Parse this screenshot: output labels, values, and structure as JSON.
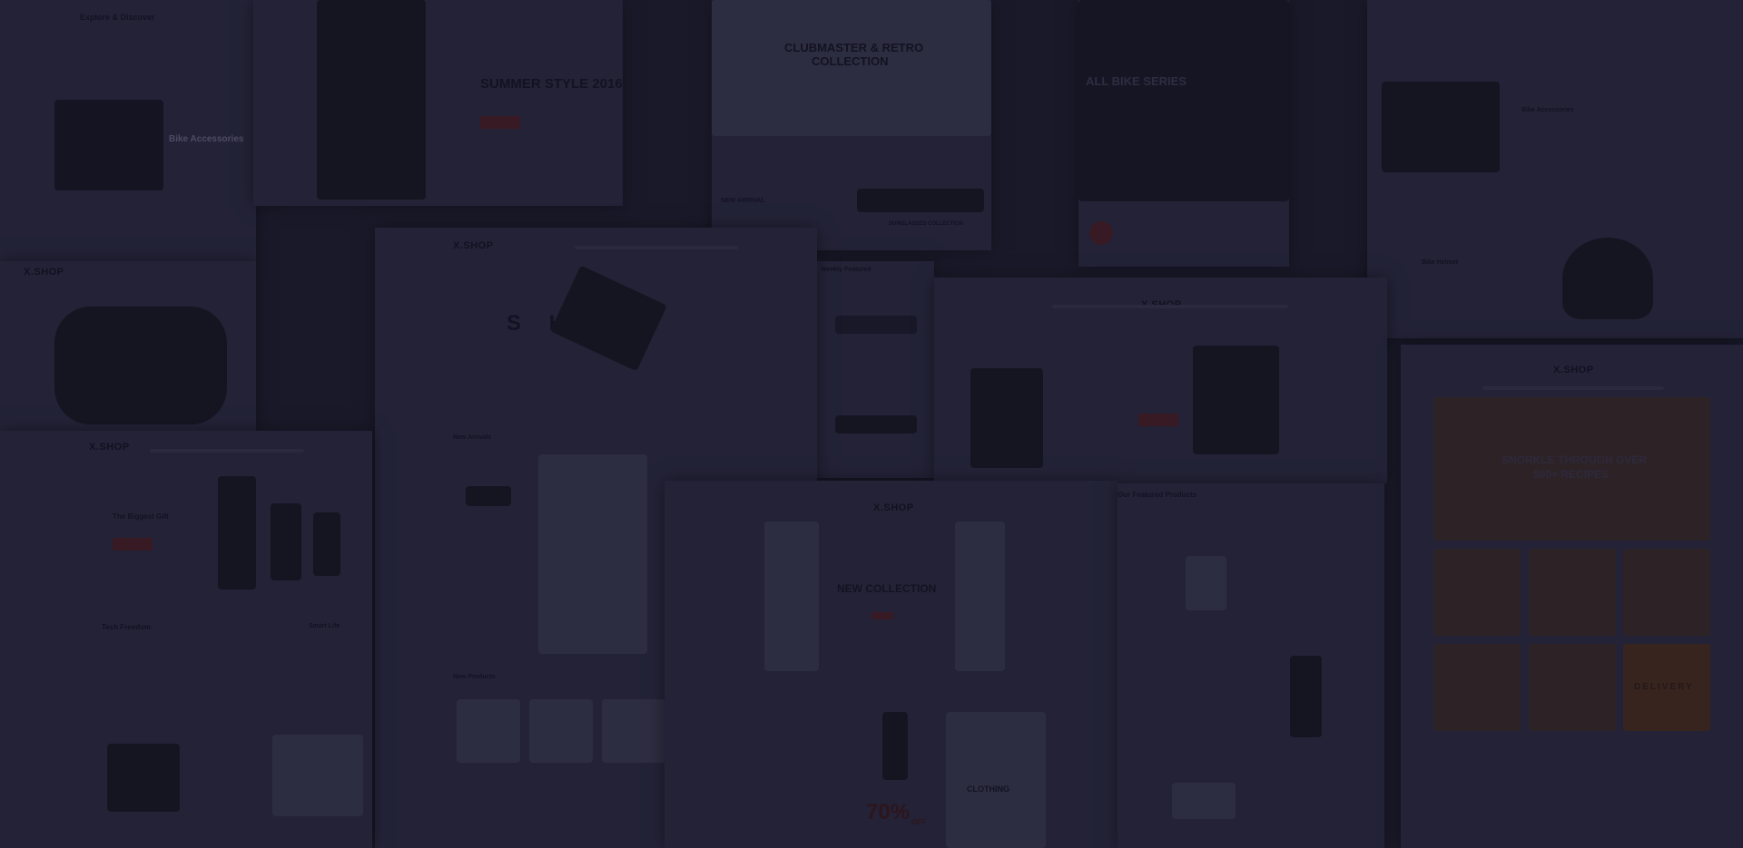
{
  "background": {
    "overlay_color": "#1c1b2b",
    "accent_color": "#4a1d22"
  },
  "templates": {
    "bike_left": {
      "title": "Explore & Discover",
      "sub": "Bike Accessories"
    },
    "summer": {
      "title": "SUMMER STYLE 2016"
    },
    "retro": {
      "title": "CLUBMASTER & RETRO",
      "title2": "COLLECTION",
      "promo": "NEW ARRIVAL",
      "glasses_caption": "SUNGLASSES COLLECTION"
    },
    "bike_series": {
      "title": "ALL BIKE SERIES"
    },
    "bike_right": {
      "sub": "Bike Accessories",
      "helmet": "Bike Helmet"
    },
    "watch": {
      "logo": "X.SHOP"
    },
    "shoes": {
      "logo": "X.SHOP",
      "hero": "S H   E S",
      "section": "New Arrivals",
      "section2": "New Products"
    },
    "glasses": {
      "title": "Weekly Featured"
    },
    "furniture": {
      "logo": "X.SHOP"
    },
    "electronics": {
      "logo": "X.SHOP",
      "hero": "The Biggest Gift",
      "tech": "Tech Freedom",
      "gadget": "Smart Life"
    },
    "collection": {
      "logo": "X.SHOP",
      "hero": "NEW COLLECTION",
      "clothing": "CLOTHING",
      "sale": "70%",
      "sale_suffix": "OFF"
    },
    "featured": {
      "title": "Our Featured Products"
    },
    "food": {
      "logo": "X.SHOP",
      "hero": "SNORKLE THROUGH OVER",
      "hero2": "500+ RECIPES",
      "tile": "DELIVERY"
    }
  }
}
